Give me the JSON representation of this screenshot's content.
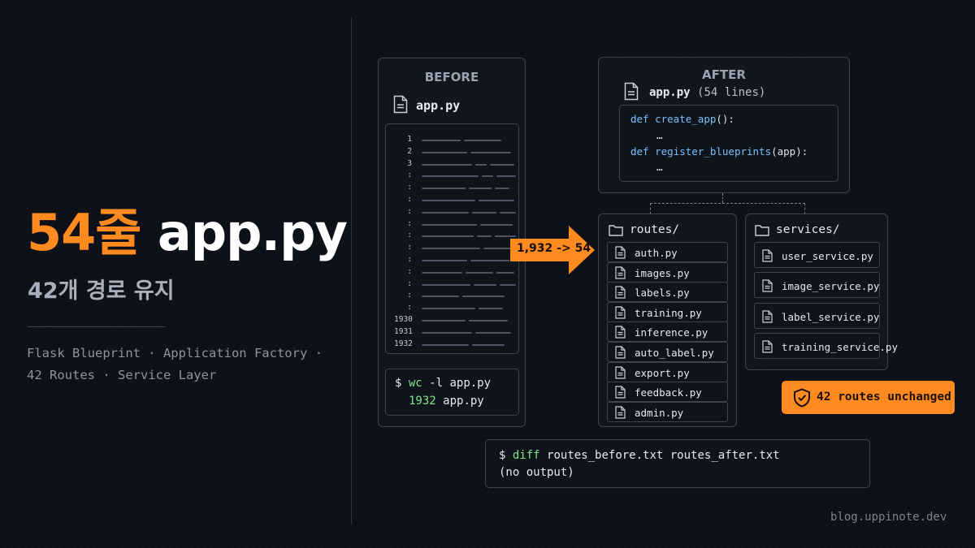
{
  "hero": {
    "highlight": "54줄",
    "rest": "app.py"
  },
  "subtitle": "42개 경로 유지",
  "tags": {
    "line1": "Flask Blueprint · Application Factory ·",
    "line2": "42 Routes · Service Layer"
  },
  "before": {
    "title": "BEFORE",
    "filename": "app.py",
    "line_numbers": [
      "1",
      "2",
      "3",
      ":",
      ":",
      ":",
      ":",
      ":",
      ":",
      ":",
      ":",
      ":",
      ":",
      ":",
      ":",
      "1930",
      "1931",
      "1932"
    ],
    "command": {
      "prompt": "$",
      "cmd": "wc",
      "args": "-l app.py",
      "count": "1932",
      "file": "app.py"
    }
  },
  "arrow_label": "1,932 -> 54",
  "after": {
    "title": "AFTER",
    "filename": "app.py",
    "lines_note": "(54 lines)",
    "code": [
      {
        "kw": "def",
        "fn": "create_app",
        "rest": "():"
      },
      {
        "ellipsis": "…"
      },
      {
        "kw": "def",
        "fn": "register_blueprints",
        "rest": "(app):"
      },
      {
        "ellipsis": "…"
      }
    ]
  },
  "routes": {
    "folder": "routes/",
    "files": [
      "auth.py",
      "images.py",
      "labels.py",
      "training.py",
      "inference.py",
      "auto_label.py",
      "export.py",
      "feedback.py",
      "admin.py"
    ]
  },
  "services": {
    "folder": "services/",
    "files": [
      "user_service.py",
      "image_service.py",
      "label_service.py",
      "training_service.py"
    ]
  },
  "badge": "42 routes unchanged",
  "diff": {
    "prompt": "$",
    "cmd": "diff",
    "args": "routes_before.txt routes_after.txt",
    "output": "(no output)"
  },
  "footer": "blog.uppinote.dev",
  "colors": {
    "accent": "#ff8a1f",
    "background": "#0d1117",
    "green": "#7ee787",
    "keyword": "#79c0ff"
  },
  "icons": [
    "file-icon",
    "folder-icon",
    "shield-check-icon",
    "arrow-right-icon"
  ]
}
